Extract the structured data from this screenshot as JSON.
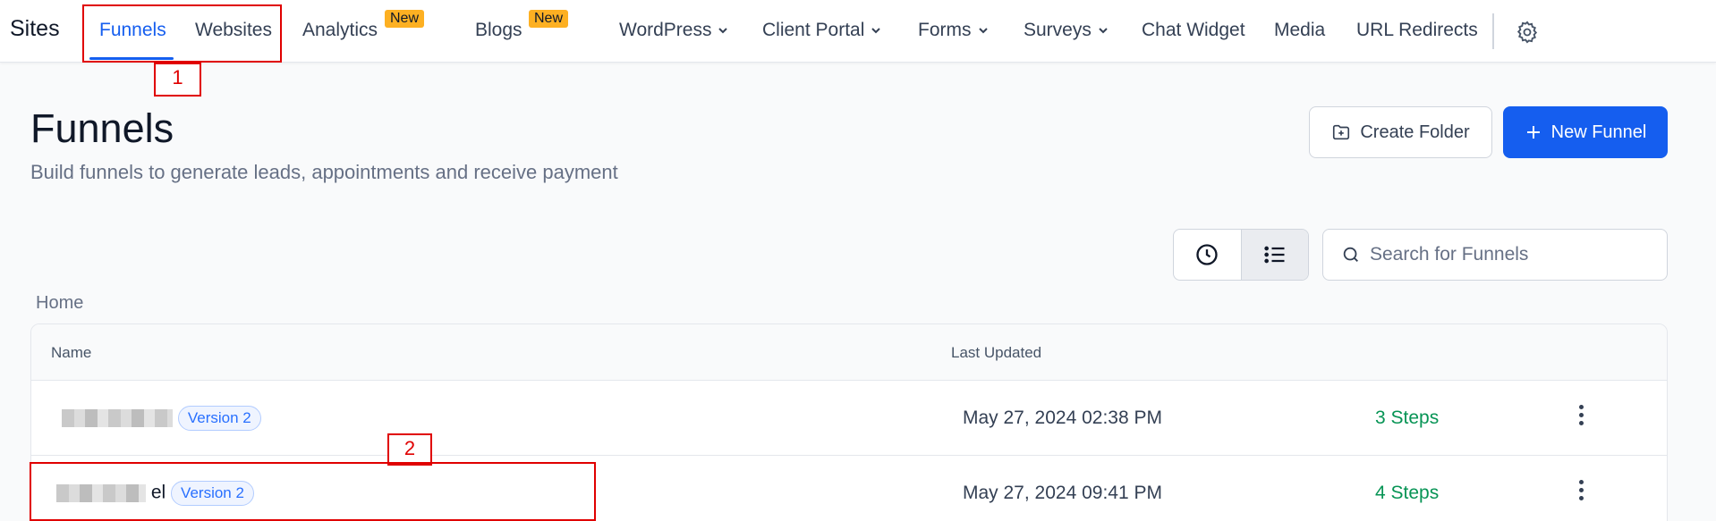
{
  "nav": {
    "brand": "Sites",
    "items": [
      {
        "label": "Funnels",
        "active": true
      },
      {
        "label": "Websites"
      },
      {
        "label": "Analytics",
        "badge": "New"
      },
      {
        "label": "Blogs",
        "badge": "New"
      },
      {
        "label": "WordPress",
        "dropdown": true
      },
      {
        "label": "Client Portal",
        "dropdown": true
      },
      {
        "label": "Forms",
        "dropdown": true
      },
      {
        "label": "Surveys",
        "dropdown": true
      },
      {
        "label": "Chat Widget"
      },
      {
        "label": "Media"
      },
      {
        "label": "URL Redirects"
      }
    ],
    "settings_icon": "gear-icon"
  },
  "annotations": [
    "1",
    "2"
  ],
  "header": {
    "title": "Funnels",
    "subtitle": "Build funnels to generate leads, appointments and receive payment",
    "create_folder_label": "Create Folder",
    "new_funnel_label": "New Funnel"
  },
  "toolbar": {
    "search_placeholder": "Search for Funnels",
    "view_icons": [
      "clock-icon",
      "list-icon"
    ]
  },
  "breadcrumb": "Home",
  "table": {
    "columns": [
      "Name",
      "Last Updated"
    ],
    "rows": [
      {
        "name_visible": "",
        "version": "Version 2",
        "updated": "May 27, 2024 02:38 PM",
        "steps": "3 Steps"
      },
      {
        "name_visible": "el",
        "version": "Version 2",
        "updated": "May 27, 2024 09:41 PM",
        "steps": "4 Steps"
      }
    ]
  },
  "colors": {
    "accent": "#155eef",
    "badge": "#fdb022",
    "steps": "#079455",
    "annotation": "#e00000"
  }
}
